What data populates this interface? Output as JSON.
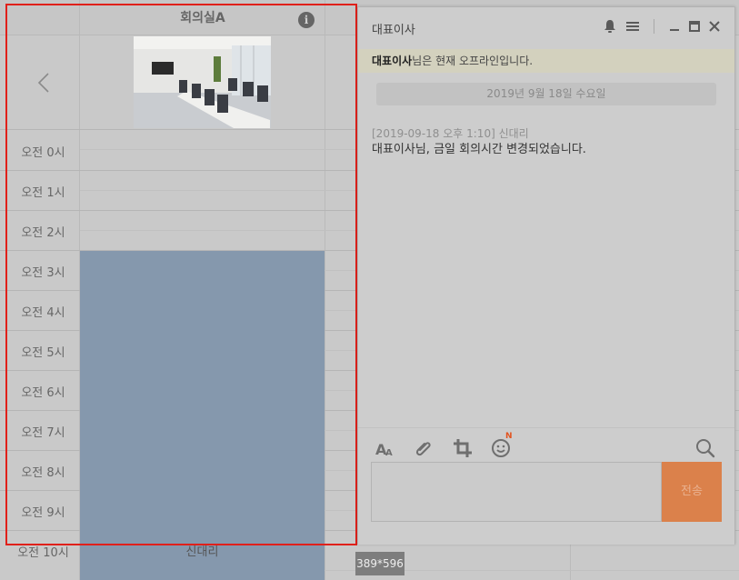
{
  "calendar": {
    "room_title": "회의실A",
    "info_icon": "i",
    "prev_icon": "chevron-left-icon",
    "prev_glyph": "〈",
    "time_slots": [
      "오전 0시",
      "오전 1시",
      "오전 2시",
      "오전 3시",
      "오전 4시",
      "오전 5시",
      "오전 6시",
      "오전 7시",
      "오전 8시",
      "오전 9시",
      "오전 10시"
    ],
    "booking": {
      "name": "신대리",
      "color": "#8598ad"
    }
  },
  "selection": {
    "size_label": "389*596",
    "frame_color": "#e0201a"
  },
  "chat": {
    "title": "대표이사",
    "offline": {
      "name": "대표이사",
      "suffix": "님은 현재 오프라인입니다."
    },
    "date_divider": "2019년 9월 18일 수요일",
    "messages": [
      {
        "meta": "[2019-09-18 오후 1:10] 신대리",
        "text": "대표이사님, 금일 회의시간 변경되었습니다."
      }
    ],
    "toolbar_icons": [
      "bell-icon",
      "menu-icon",
      "minimize-icon",
      "maximize-icon",
      "close-icon"
    ],
    "footer_icons": [
      "font-size-icon",
      "attach-icon",
      "capture-icon",
      "emoji-icon",
      "search-icon"
    ],
    "emoji_badge": "N",
    "send_label": "전송",
    "send_color": "#db814b"
  }
}
